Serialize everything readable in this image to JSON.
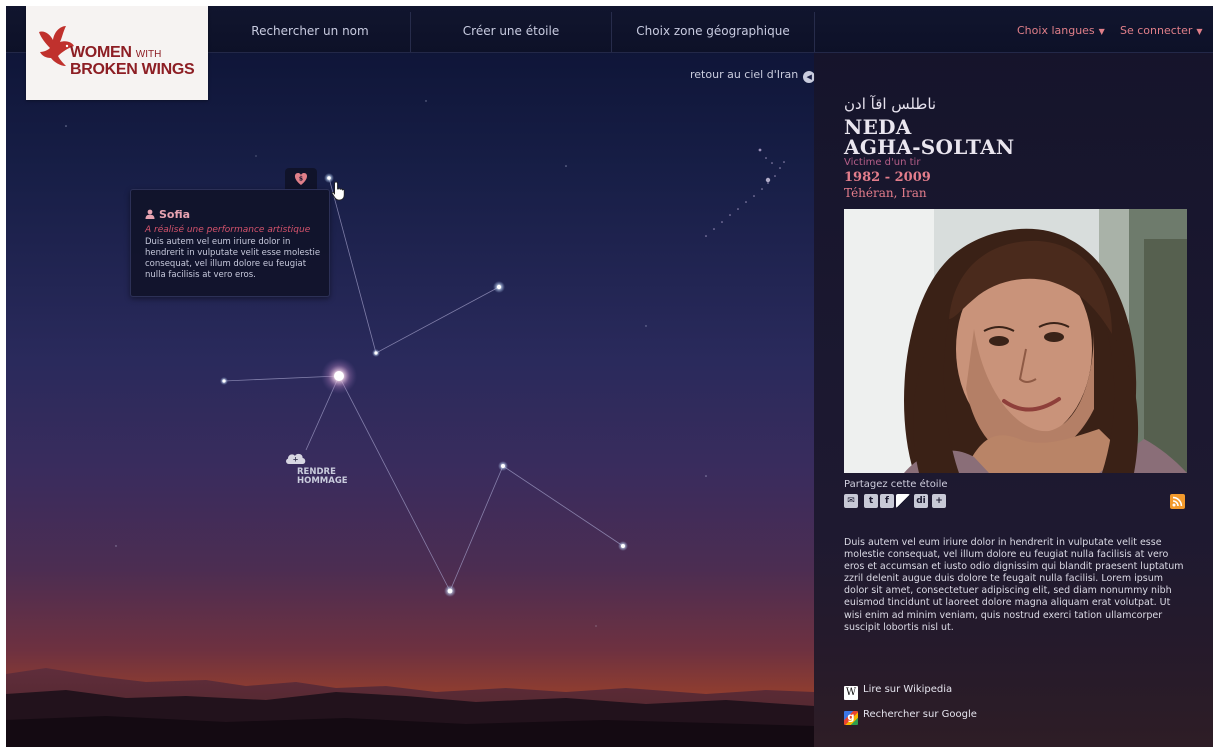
{
  "nav": {
    "items": [
      "Rechercher un nom",
      "Créer une étoile",
      "Choix zone géographique"
    ],
    "languages": "Choix langues",
    "login": "Se connecter"
  },
  "logo": {
    "line1_big": "WOMEN",
    "line1_small": "WITH",
    "line2": "BROKEN WINGS"
  },
  "sky": {
    "back_link": "retour au ciel d'Iran",
    "tooltip": {
      "name": "Sofia",
      "subtitle": "A réalisé une performance artistique",
      "body": "Duis autem vel eum iriure dolor in hendrerit in vulputate velit esse molestie consequat, vel illum dolore eu feugiat nulla facilisis at vero eros."
    },
    "hommage": {
      "line1": "RENDRE",
      "line2": "HOMMAGE"
    }
  },
  "profile": {
    "arabic_name": "ناطلس اقآ ادن",
    "first_name": "NEDA",
    "last_name": "AGHA-SOLTAN",
    "cause": "Victime d'un tir",
    "years": "1982 - 2009",
    "place": "Téhéran, Iran",
    "share_label": "Partagez cette étoile",
    "bio": "Duis autem vel eum iriure dolor in hendrerit in vulputate velit esse molestie consequat, vel illum dolore eu feugiat nulla facilisis at vero eros et accumsan et iusto odio dignissim qui blandit praesent luptatum zzril delenit augue duis dolore te feugait nulla facilisi. Lorem ipsum dolor sit amet, consectetuer adipiscing elit, sed diam nonummy nibh euismod tincidunt ut laoreet dolore magna aliquam erat volutpat. Ut wisi enim ad minim veniam, quis nostrud exerci tation ullamcorper suscipit lobortis nisl ut.",
    "wiki_link": "Lire sur Wikipedia",
    "google_link": "Rechercher sur Google"
  },
  "colors": {
    "accent": "#e07f89",
    "logo_red": "#8d1e24",
    "sky_top": "#0c1233",
    "horizon": "#c4561f"
  },
  "icons": [
    "heart-dollar-icon",
    "hand-cursor-icon",
    "person-icon",
    "cloud-plus-icon",
    "back-arrow-icon",
    "email-icon",
    "twitter-icon",
    "facebook-icon",
    "delicious-icon",
    "digg-icon",
    "addthis-icon",
    "rss-icon",
    "wikipedia-icon",
    "google-icon"
  ]
}
